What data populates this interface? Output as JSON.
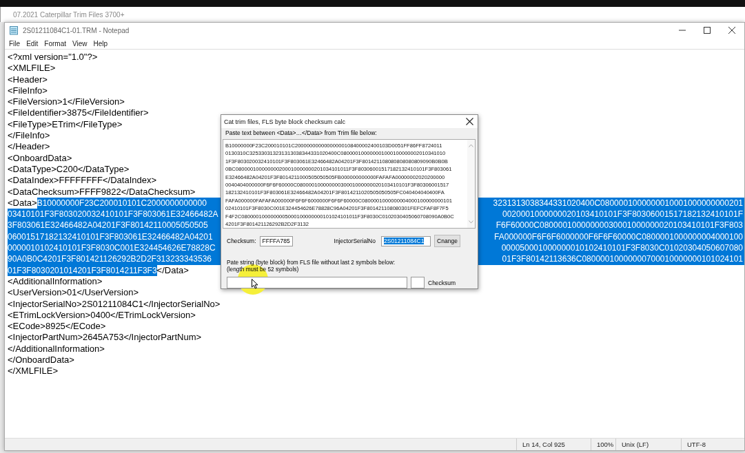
{
  "background_window": {
    "title": "07.2021 Caterpillar Trim Files 3700+"
  },
  "notepad": {
    "title": "2S01211084C1-01.TRM - Notepad",
    "menu": [
      "File",
      "Edit",
      "Format",
      "View",
      "Help"
    ],
    "lines": [
      {
        "kind": "text",
        "text": "<?xml version=\"1.0\"?>"
      },
      {
        "kind": "text",
        "text": "<XMLFILE>"
      },
      {
        "kind": "text",
        "text": "<Header>"
      },
      {
        "kind": "text",
        "text": "<FileInfo>"
      },
      {
        "kind": "text",
        "text": "<FileVersion>1</FileVersion>"
      },
      {
        "kind": "text",
        "text": "<FileIdentifier>3875</FileIdentifier>"
      },
      {
        "kind": "text",
        "text": "<FileType>ETrim</FileType>"
      },
      {
        "kind": "text",
        "text": "</FileInfo>"
      },
      {
        "kind": "text",
        "text": "</Header>"
      },
      {
        "kind": "text",
        "text": "<OnboardData>"
      },
      {
        "kind": "text",
        "text": "<DataType>C200</DataType>"
      },
      {
        "kind": "text",
        "text": "<DataIndex>FFFFFFFF</DataIndex>"
      },
      {
        "kind": "text",
        "text": "<DataChecksum>FFFF9822</DataChecksum>"
      },
      {
        "kind": "data_start",
        "tag": "<Data>",
        "left": "B10000000F23C200010101C2000000000000",
        "right": "3231313038344331020400C0800001000000010001000000000201"
      },
      {
        "kind": "data",
        "left": "03410101F3F803020032410101F3F803061E32466482A",
        "right": "0020001000000020103410101F3F80306001517182132410101F"
      },
      {
        "kind": "data",
        "left": "3F803061E32466482A04201F3F80142110005050505",
        "right": "F6F60000C08000010000000030001000000020103410101F3F803"
      },
      {
        "kind": "data",
        "left": "06001517182132410101F3F803061E32466482A04201",
        "right": "FA000000F6F6F6000000F6F6F60000C0800001000000004000100"
      },
      {
        "kind": "data",
        "left": "0000010102410101F3F8030C001E324454626E78828C",
        "right": "000050001000000010102410101F3F8030C01020304050607080"
      },
      {
        "kind": "data",
        "left": "90A0B0C4201F3F801421126292B2D2F313233343536",
        "right": "01F3F80142113636C08000010000000700010000000101024101"
      },
      {
        "kind": "data_end",
        "left": "01F3F8030201014201F3F8014211F3F3",
        "tag": "</Data>"
      },
      {
        "kind": "text",
        "text": "<AdditionalInformation>"
      },
      {
        "kind": "text",
        "text": "<UserVersion>01</UserVersion>"
      },
      {
        "kind": "text",
        "text": "<InjectorSerialNo>2S01211084C1</InjectorSerialNo>"
      },
      {
        "kind": "text",
        "text": "<ETrimLockVersion>0400</ETrimLockVersion>"
      },
      {
        "kind": "text",
        "text": "<ECode>8925</ECode>"
      },
      {
        "kind": "text",
        "text": "<InjectorPartNum>2645A753</InjectorPartNum>"
      },
      {
        "kind": "text",
        "text": "</AdditionalInformation>"
      },
      {
        "kind": "text",
        "text": "</OnboardData>"
      },
      {
        "kind": "text",
        "text": "</XMLFILE>"
      }
    ],
    "status_bar": {
      "position": "Ln 14, Col 925",
      "zoom": "100%",
      "line_ending": "Unix (LF)",
      "encoding": "UTF-8"
    }
  },
  "dialog": {
    "title": "Cat trim files, FLS byte block checksum calc",
    "instruction": "Paste text between <Data>…</Data>  from Trim file below:",
    "pasted_lines": [
      "B10000000F23C200010101C20000000000000000108400002400103D0051FF86FF8724011",
      "0130310C325330313231313038344331020400C080000100000001000100000002010341010",
      "1F3F803020032410101F3F803061E32466482A04201F3F801421108080808080809090B0B0B",
      "0BC080000100000000200010000000201034101011F3F80306001517182132410101F3F803061",
      "E32466482A04201F3F8014211000505050505FB000000000000FAFAFA00000002020200000",
      "0040404000000F6F6F60000C08000010000000030001000000020103410101F3F80306001517",
      "182132410101F3F803061E32466482A04201F3F8014211020505050505FC040404040400FA",
      "FAFA000000FAFAFA000000F6F6F6000000F6F6F60000C0800001000000004000100000000101",
      "02410101F3F8030C001E324454626E78828C96A04201F3F801421108080301FEFCFAF8F7F5",
      "F4F2C0800001000000005000100000000101024101011F3F8030C0102030405060708090A0B0C",
      "4201F3F801421126292B2D2F3132"
    ],
    "checksum_label": "Checksum:",
    "checksum_value": "FFFFA785",
    "serial_label": "InjectorSerialNo",
    "serial_value": "2S01211084C1",
    "serial_selected": true,
    "change_button": "Cnange",
    "note_lines": [
      "Pate string (byte block) from FLS file without last 2 symbols below:",
      "(length must be 52 symbols)"
    ],
    "result_label": "Checksum"
  }
}
